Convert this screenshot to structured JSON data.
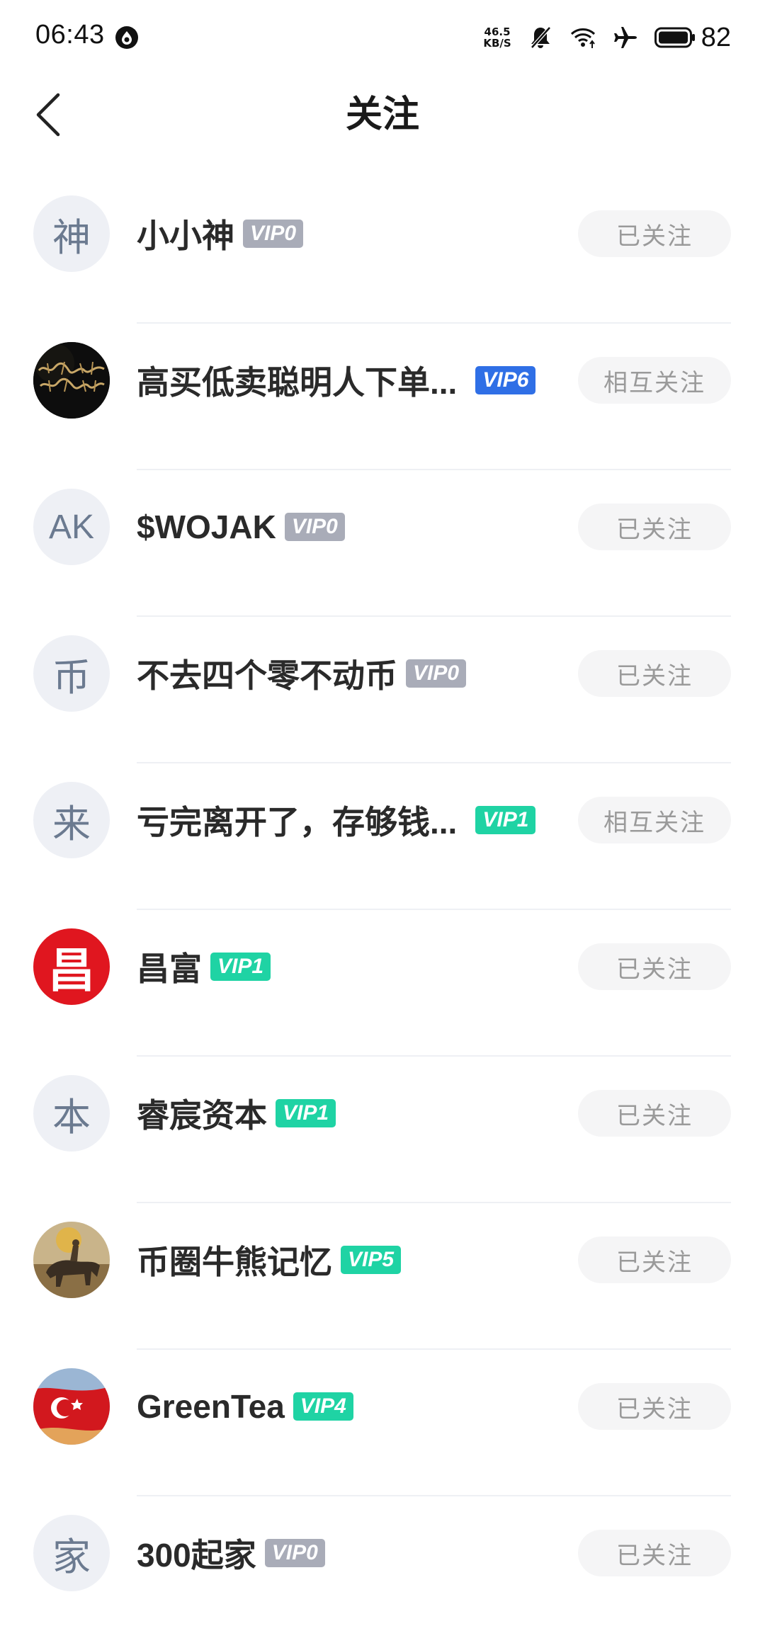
{
  "status_bar": {
    "time": "06:43",
    "net_speed_value": "46.5",
    "net_speed_unit": "KB/S",
    "battery": "82"
  },
  "header": {
    "title": "关注"
  },
  "colors": {
    "vip0": "#a9acb8",
    "vip1": "#1fd3a4",
    "vip4": "#1fd3a4",
    "vip5": "#1fd3a4",
    "vip6": "#2f6fe6"
  },
  "items": [
    {
      "avatar_text": "神",
      "name": "小小神",
      "vip": "VIP0",
      "button": "已关注"
    },
    {
      "avatar_text": "",
      "name": "高买低卖聪明人下单...",
      "vip": "VIP6",
      "button": "相互关注"
    },
    {
      "avatar_text": "AK",
      "name": "$WOJAK",
      "vip": "VIP0",
      "button": "已关注"
    },
    {
      "avatar_text": "币",
      "name": "不去四个零不动币",
      "vip": "VIP0",
      "button": "已关注"
    },
    {
      "avatar_text": "来",
      "name": "亏完离开了，存够钱...",
      "vip": "VIP1",
      "button": "相互关注"
    },
    {
      "avatar_text": "昌",
      "name": "昌富",
      "vip": "VIP1",
      "button": "已关注"
    },
    {
      "avatar_text": "本",
      "name": "睿宸资本",
      "vip": "VIP1",
      "button": "已关注"
    },
    {
      "avatar_text": "",
      "name": "币圈牛熊记忆",
      "vip": "VIP5",
      "button": "已关注"
    },
    {
      "avatar_text": "",
      "name": "GreenTea",
      "vip": "VIP4",
      "button": "已关注"
    },
    {
      "avatar_text": "家",
      "name": "300起家",
      "vip": "VIP0",
      "button": "已关注"
    }
  ]
}
